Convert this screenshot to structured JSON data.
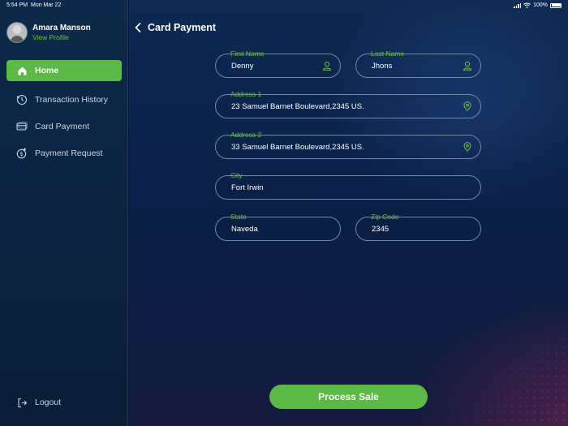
{
  "status_bar": {
    "time": "5:54 PM",
    "date": "Mon Mar 22",
    "battery": "100%"
  },
  "profile": {
    "name": "Amara Manson",
    "link": "View Profile"
  },
  "sidebar": {
    "items": [
      {
        "label": "Home",
        "icon": "home-icon",
        "active": true
      },
      {
        "label": "Transaction History",
        "icon": "history-icon"
      },
      {
        "label": "Card Payment",
        "icon": "card-icon"
      },
      {
        "label": "Payment Request",
        "icon": "payment-request-icon"
      }
    ],
    "logout": "Logout"
  },
  "header": {
    "title": "Card Payment"
  },
  "form": {
    "first_name": {
      "label": "First Name",
      "value": "Denny"
    },
    "last_name": {
      "label": "Last Name",
      "value": "Jhons"
    },
    "address1": {
      "label": "Address 1",
      "value": "23 Samuel Barnet Boulevard,2345 US."
    },
    "address2": {
      "label": "Address 2",
      "value": "33 Samuel Barnet Boulevard,2345 US."
    },
    "city": {
      "label": "City",
      "value": "Fort Irwin"
    },
    "state": {
      "label": "State",
      "value": "Naveda"
    },
    "zip": {
      "label": "Zip Code",
      "value": "2345"
    }
  },
  "actions": {
    "process_label": "Process Sale"
  },
  "colors": {
    "accent": "#5cb946",
    "background": "#0b1e44",
    "field_border": "#6f8aa6"
  }
}
